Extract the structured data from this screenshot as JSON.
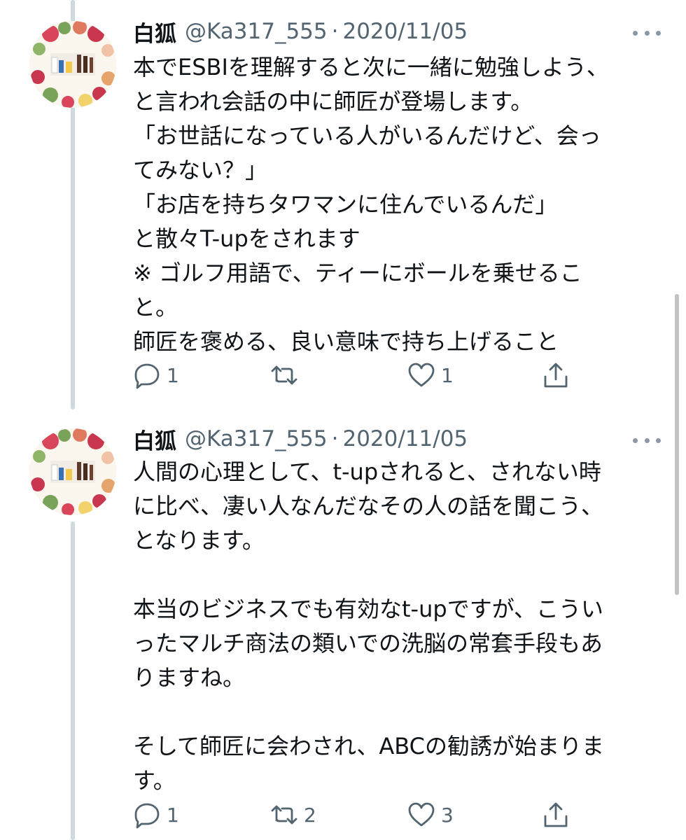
{
  "tweets": [
    {
      "name": "白狐",
      "handle": "@Ka317_555",
      "separator": "·",
      "date": "2020/11/05",
      "lines": [
        "本でESBIを理解すると次に一緒に勉強しよう、",
        "と言われ会話の中に師匠が登場します。",
        "「お世話になっている人がいるんだけど、会っ",
        "てみない？」",
        "「お店を持ちタワマンに住んでいるんだ」",
        "と散々T-upをされます",
        "※ ゴルフ用語で、ティーにボールを乗せるこ",
        "と。",
        "師匠を褒める、良い意味で持ち上げること"
      ],
      "reply_count": "1",
      "retweet_count": "",
      "like_count": "1"
    },
    {
      "name": "白狐",
      "handle": "@Ka317_555",
      "separator": "·",
      "date": "2020/11/05",
      "lines": [
        "人間の心理として、t-upされると、されない時",
        "に比べ、凄い人なんだなその人の話を聞こう、",
        "となります。",
        "",
        "本当のビジネスでも有効なt-upですが、こうい",
        "ったマルチ商法の類いでの洗脳の常套手段もあ",
        "りますね。",
        "",
        "そして師匠に会わされ、ABCの勧誘が始まりま",
        "す。"
      ],
      "reply_count": "1",
      "retweet_count": "2",
      "like_count": "3"
    }
  ],
  "icons": {
    "more": "more-icon",
    "reply": "reply-icon",
    "retweet": "retweet-icon",
    "like": "heart-icon",
    "share": "share-icon"
  },
  "colors": {
    "text": "#0f1419",
    "secondary": "#536471",
    "thread_line": "#cfd9de"
  }
}
